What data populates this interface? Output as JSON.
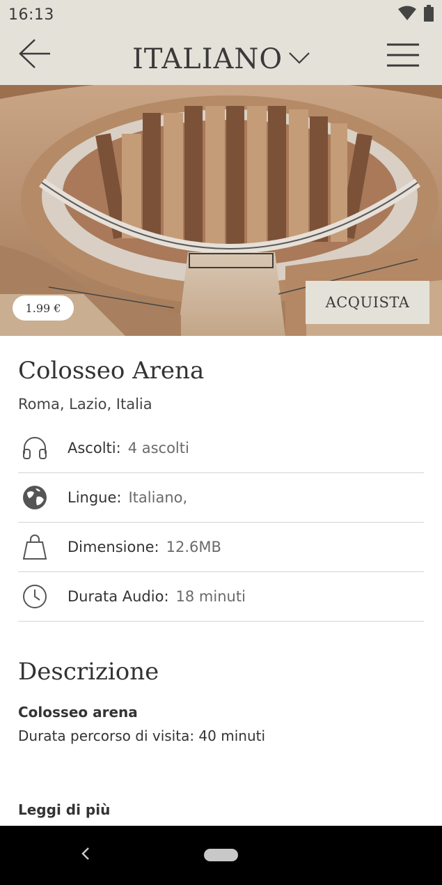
{
  "status_bar": {
    "time": "16:13",
    "icons": [
      "wifi-icon",
      "battery-icon"
    ]
  },
  "header": {
    "language": "ITALIANO",
    "icons": [
      "back-arrow-icon",
      "chevron-down-icon",
      "menu-icon"
    ]
  },
  "hero": {
    "price": "1.99 €",
    "buy_label": "ACQUISTA"
  },
  "detail": {
    "title": "Colosseo Arena",
    "location": "Roma, Lazio, Italia",
    "info": [
      {
        "icon": "headphones-icon",
        "label": "Ascolti:",
        "value": "4 ascolti"
      },
      {
        "icon": "globe-icon",
        "label": "Lingue:",
        "value": "Italiano,"
      },
      {
        "icon": "bag-icon",
        "label": "Dimensione:",
        "value": "12.6MB"
      },
      {
        "icon": "clock-icon",
        "label": "Durata Audio:",
        "value": "18 minuti"
      }
    ]
  },
  "description": {
    "section_title": "Descrizione",
    "heading": "Colosseo arena",
    "line": "Durata percorso di visita: 40 minuti",
    "read_more": "Leggi di più"
  },
  "colors": {
    "header_bg": "#e4e1d9",
    "text": "#333333",
    "divider": "#d6d3cc"
  }
}
